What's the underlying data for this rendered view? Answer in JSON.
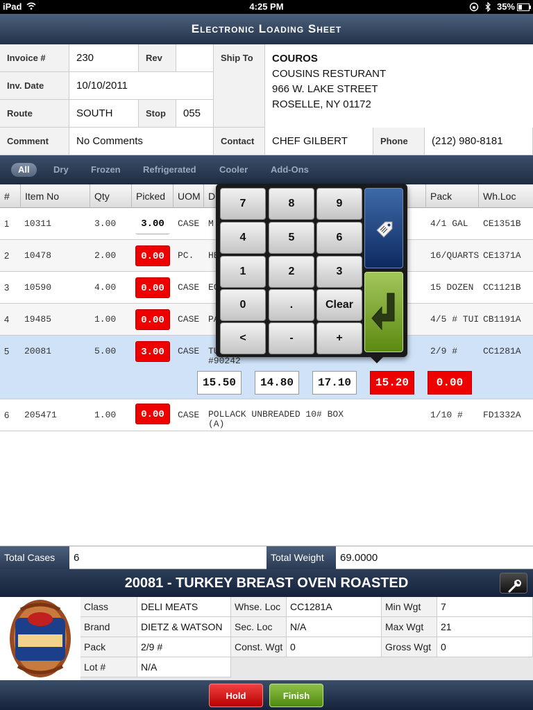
{
  "status": {
    "carrier": "iPad",
    "time": "4:25 PM",
    "battery": "35%"
  },
  "title": "Electronic Loading Sheet",
  "header": {
    "invoice_label": "Invoice #",
    "invoice": "230",
    "rev_label": "Rev",
    "rev": "",
    "inv_date_label": "Inv. Date",
    "inv_date": "10/10/2011",
    "route_label": "Route",
    "route": "SOUTH",
    "stop_label": "Stop",
    "stop": "055",
    "comment_label": "Comment",
    "comment": "No Comments",
    "ship_to_label": "Ship To",
    "ship_code": "COUROS",
    "ship_name": "COUSINS RESTURANT",
    "ship_street": "966 W. LAKE STREET",
    "ship_city": "ROSELLE, NY 01172",
    "contact_label": "Contact",
    "contact": "CHEF GILBERT",
    "phone_label": "Phone",
    "phone": "(212) 980-8181"
  },
  "tabs": [
    "All",
    "Dry",
    "Frozen",
    "Refrigerated",
    "Cooler",
    "Add-Ons"
  ],
  "columns": [
    "#",
    "Item No",
    "Qty",
    "Picked",
    "UOM",
    "D",
    "Pack",
    "Wh.Loc"
  ],
  "rows": [
    {
      "n": "1",
      "item": "10311",
      "qty": "3.00",
      "picked": "3.00",
      "uom": "CASE",
      "desc": "M",
      "pack": "4/1 GAL",
      "loc": "CE1351B"
    },
    {
      "n": "2",
      "item": "10478",
      "qty": "2.00",
      "picked": "0.00",
      "uom": "PC.",
      "desc": "HE",
      "pack": "16/QUARTS",
      "loc": "CE1371A"
    },
    {
      "n": "3",
      "item": "10590",
      "qty": "4.00",
      "picked": "0.00",
      "uom": "CASE",
      "desc": "EG",
      "pack": "15 DOZEN",
      "loc": "CC1121B"
    },
    {
      "n": "4",
      "item": "19485",
      "qty": "1.00",
      "picked": "0.00",
      "uom": "CASE",
      "desc": "PA",
      "pack": "4/5 # TUI",
      "loc": "CB1191A"
    },
    {
      "n": "5",
      "item": "20081",
      "qty": "5.00",
      "picked": "3.00",
      "uom": "CASE",
      "desc": "TU",
      "desc2": "#90242",
      "pack": "2/9 #",
      "loc": "CC1281A"
    },
    {
      "n": "6",
      "item": "205471",
      "qty": "1.00",
      "picked": "0.00",
      "uom": "CASE",
      "desc": "POLLACK UNBREADED 10# BOX",
      "desc2": "(A)",
      "pack": "1/10 #",
      "loc": "FD1332A"
    }
  ],
  "weights": [
    "15.50",
    "14.80",
    "17.10",
    "15.20",
    "0.00"
  ],
  "keypad": [
    "7",
    "8",
    "9",
    "4",
    "5",
    "6",
    "1",
    "2",
    "3",
    "0",
    ".",
    "Clear",
    "<",
    "-",
    "+"
  ],
  "totals": {
    "cases_label": "Total Cases",
    "cases": "6",
    "weight_label": "Total Weight",
    "weight": "69.0000"
  },
  "item_title": "20081 - TURKEY BREAST OVEN ROASTED",
  "details": {
    "class_label": "Class",
    "class": "DELI MEATS",
    "brand_label": "Brand",
    "brand": "DIETZ & WATSON",
    "pack_label": "Pack",
    "pack": "2/9 #",
    "lot_label": "Lot #",
    "lot": "N/A",
    "whse_label": "Whse. Loc",
    "whse": "CC1281A",
    "sec_label": "Sec. Loc",
    "sec": "N/A",
    "const_label": "Const. Wgt",
    "const": "0",
    "min_label": "Min Wgt",
    "min": "7",
    "max_label": "Max Wgt",
    "max": "21",
    "gross_label": "Gross Wgt",
    "gross": "0"
  },
  "footer": {
    "hold": "Hold",
    "finish": "Finish"
  },
  "colors": {
    "red": "#e00000",
    "green": "#6a9a1c",
    "navy": "#233249",
    "selected_row": "#cfe2f8"
  }
}
